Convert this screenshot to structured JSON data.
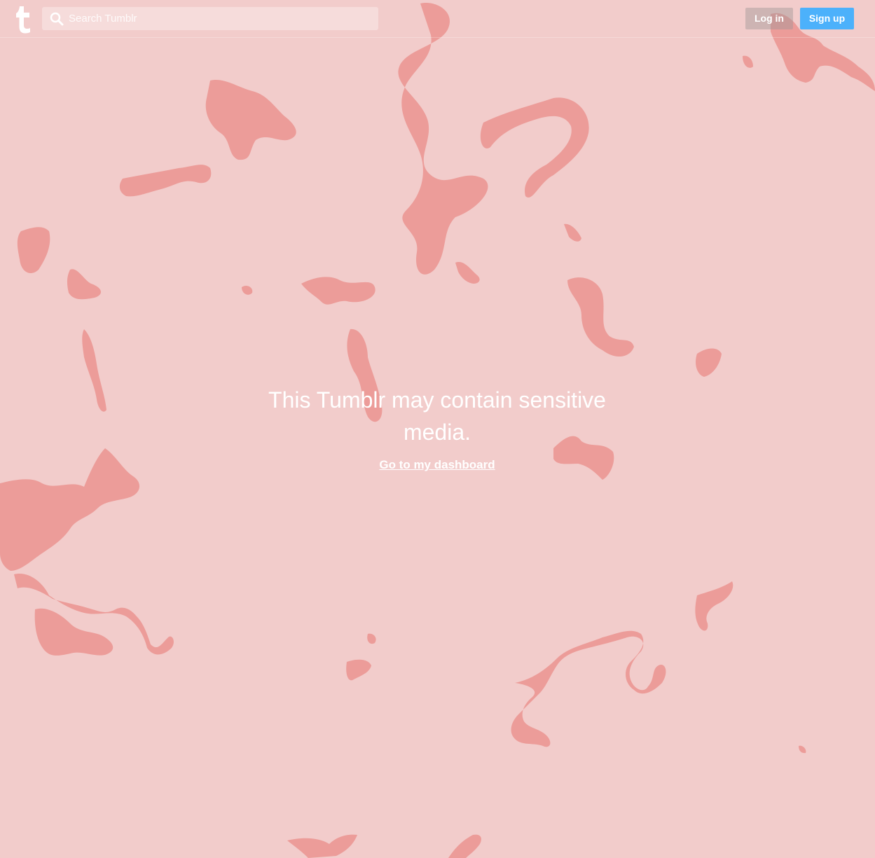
{
  "page": {
    "background_color": "#f2cccb",
    "blob_color": "#ec9c99"
  },
  "header": {
    "logo_icon": "tumblr-t-icon",
    "search": {
      "icon": "search-icon",
      "placeholder": "Search Tumblr",
      "value": ""
    },
    "login_label": "Log in",
    "signup_label": "Sign up",
    "signup_color": "#4cb1fb"
  },
  "main": {
    "message": "This Tumblr may contain sensitive media.",
    "dashboard_link": "Go to my dashboard"
  }
}
